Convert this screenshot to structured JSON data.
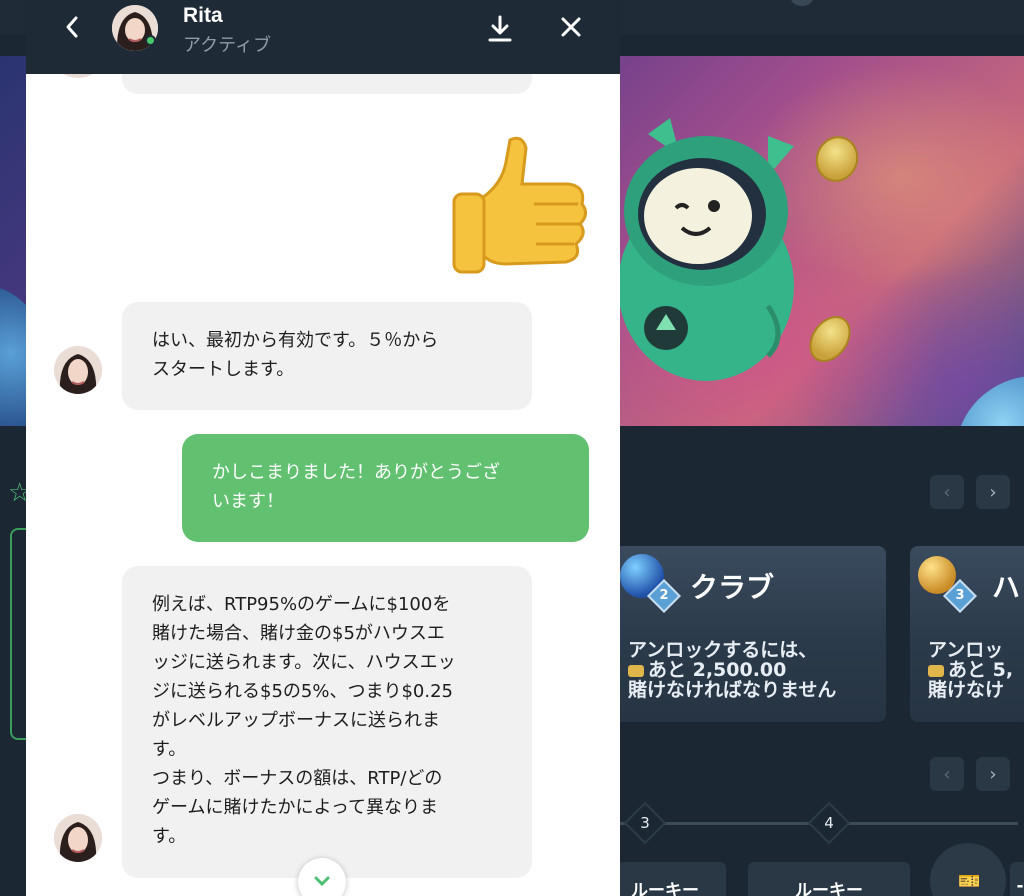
{
  "chat": {
    "agent_name": "Rita",
    "agent_status": "アクティブ",
    "messages": [
      {
        "from": "agent",
        "text": "はい、最初から有効です。５％から\nスタートします。"
      },
      {
        "from": "user",
        "text": "かしこまりました！ありがとうござ\nいます！"
      },
      {
        "from": "agent",
        "text": "例えば、RTP95%のゲームに$100を\n賭けた場合、賭け金の$5がハウスエ\nッジに送られます。次に、ハウスエッ\nジに送られる$5の5%、つまり$0.25\nがレベルアップボーナスに送られま\nす。\nつまり、ボーナスの額は、RTP/どの\nゲームに賭けたかによって異なりま\nす。"
      }
    ],
    "icons": {
      "back": "chevron-left-icon",
      "download": "download-icon",
      "close": "close-icon",
      "scroll": "chevron-down-icon",
      "sticker": "thumbs-up-icon"
    }
  },
  "background": {
    "clubs": [
      {
        "title": "クラブ",
        "badge": "2",
        "unlock_line1": "アンロックするには、",
        "unlock_line2": "あと 2,500.00",
        "unlock_line3": "賭けなければなりません"
      },
      {
        "title": "ハ",
        "badge": "3",
        "unlock_line1": "アンロッ",
        "unlock_line2": "あと 5,",
        "unlock_line3": "賭けなけ"
      }
    ],
    "levels": [
      "3",
      "4"
    ],
    "ranks": [
      "ルーキー",
      "ルーキー",
      "-"
    ],
    "nav": {
      "prev": "‹",
      "next": "›"
    },
    "colors": {
      "accent_green": "#62c170",
      "header_dark": "#1e2a36",
      "page_bg": "#1b2733"
    }
  }
}
